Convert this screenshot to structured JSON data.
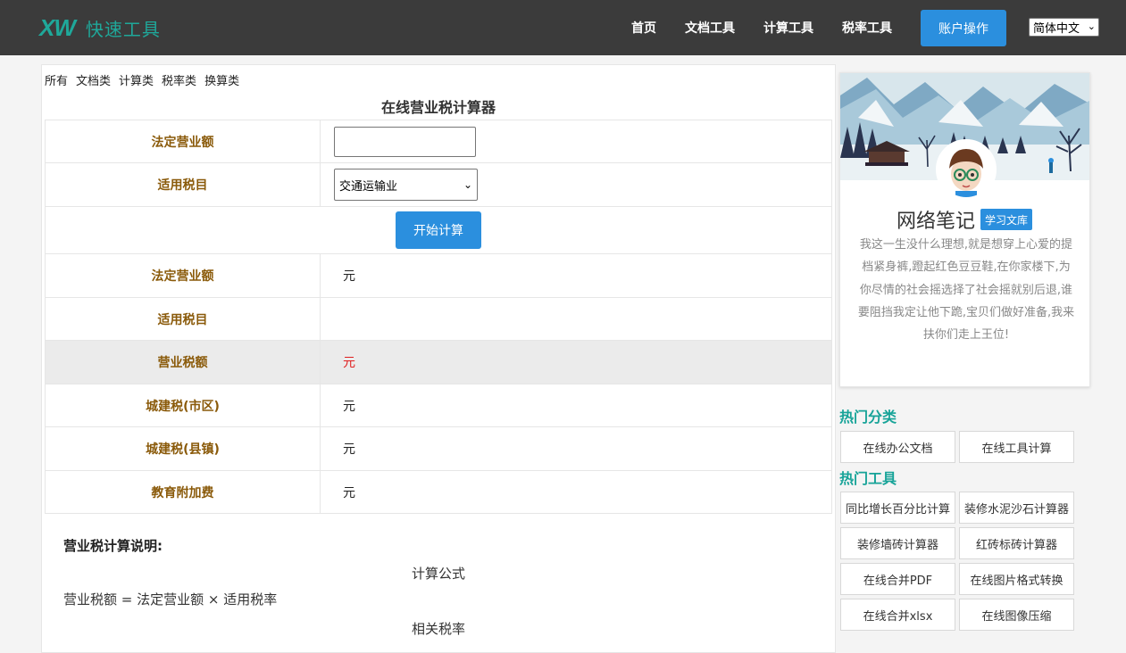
{
  "header": {
    "logo_mark": "XW",
    "logo_text": "快速工具",
    "nav": [
      "首页",
      "文档工具",
      "计算工具",
      "税率工具"
    ],
    "account_button": "账户操作",
    "language": "简体中文"
  },
  "categories": [
    "所有",
    "文档类",
    "计算类",
    "税率类",
    "换算类"
  ],
  "page_title": "在线营业税计算器",
  "form": {
    "revenue_label": "法定营业额",
    "revenue_value": "",
    "tax_item_label": "适用税目",
    "tax_item_selected": "交通运输业",
    "calc_button": "开始计算"
  },
  "results": [
    {
      "label": "法定营业额",
      "value": "元"
    },
    {
      "label": "适用税目",
      "value": ""
    },
    {
      "label": "营业税额",
      "value": "元"
    },
    {
      "label": "城建税(市区)",
      "value": "元"
    },
    {
      "label": "城建税(县镇)",
      "value": "元"
    },
    {
      "label": "教育附加费",
      "value": "元"
    }
  ],
  "description": {
    "title": "营业税计算说明:",
    "formula_heading": "计算公式",
    "formula": "营业税额 = 法定营业额 × 适用税率",
    "rate_heading": "相关税率"
  },
  "profile": {
    "name": "网络笔记",
    "badge": "学习文库",
    "bio": "我这一生没什么理想,就是想穿上心爱的提档紧身裤,蹬起红色豆豆鞋,在你家楼下,为你尽情的社会摇选择了社会摇就别后退,谁要阻挡我定让他下跪,宝贝们做好准备,我来扶你们走上王位!"
  },
  "hot_categories": {
    "title": "热门分类",
    "items": [
      "在线办公文档",
      "在线工具计算"
    ]
  },
  "hot_tools": {
    "title": "热门工具",
    "items": [
      "同比增长百分比计算",
      "装修水泥沙石计算器",
      "装修墙砖计算器",
      "红砖标砖计算器",
      "在线合并PDF",
      "在线图片格式转换",
      "在线合并xlsx",
      "在线图像压缩"
    ]
  },
  "colors": {
    "accent": "#2b8fde",
    "brand": "#1fa89a",
    "label": "#8a5a0a",
    "tax_value": "#e02020"
  }
}
